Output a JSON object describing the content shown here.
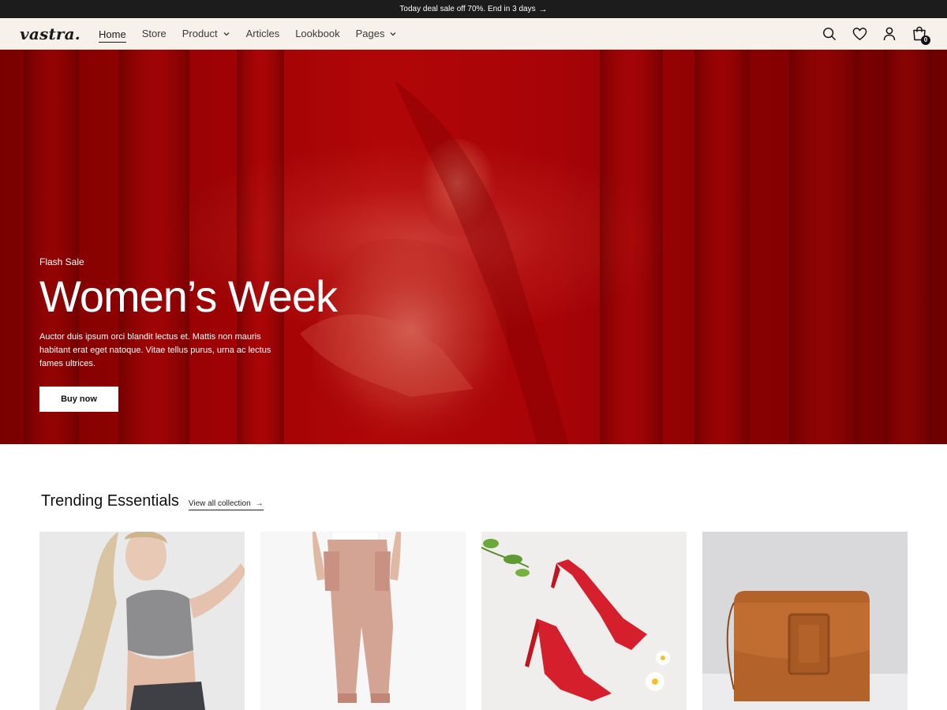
{
  "announcement": {
    "text": "Today deal sale off 70%. End in 3 days",
    "arrow": "→"
  },
  "header": {
    "logo": "vastra.",
    "nav": [
      {
        "label": "Home"
      },
      {
        "label": "Store"
      },
      {
        "label": "Product"
      },
      {
        "label": "Articles"
      },
      {
        "label": "Lookbook"
      },
      {
        "label": "Pages"
      }
    ],
    "icons": [
      "search-icon",
      "heart-icon",
      "user-icon",
      "cart-icon"
    ],
    "cart_count": "0"
  },
  "hero": {
    "eyebrow": "Flash Sale",
    "title": "Women’s Week",
    "text": "Auctor duis ipsum orci blandit lectus et. Mattis non mauris habitant erat eget natoque. Vitae tellus purus, urna ac lectus fames ultrices.",
    "button": "Buy now",
    "accent_color": "#a40407"
  },
  "trending": {
    "title": "Trending Essentials",
    "view_all": "View all collection",
    "view_all_arrow": "→",
    "products": [
      {
        "image": "woman-grey-crop-top"
      },
      {
        "image": "pink-jogger-pants"
      },
      {
        "image": "red-heels"
      },
      {
        "image": "brown-leather-bag"
      }
    ]
  },
  "colors": {
    "topbar": "#1c1c1c",
    "header_bg": "#f7f1ec",
    "button_bg": "#ffffff"
  }
}
